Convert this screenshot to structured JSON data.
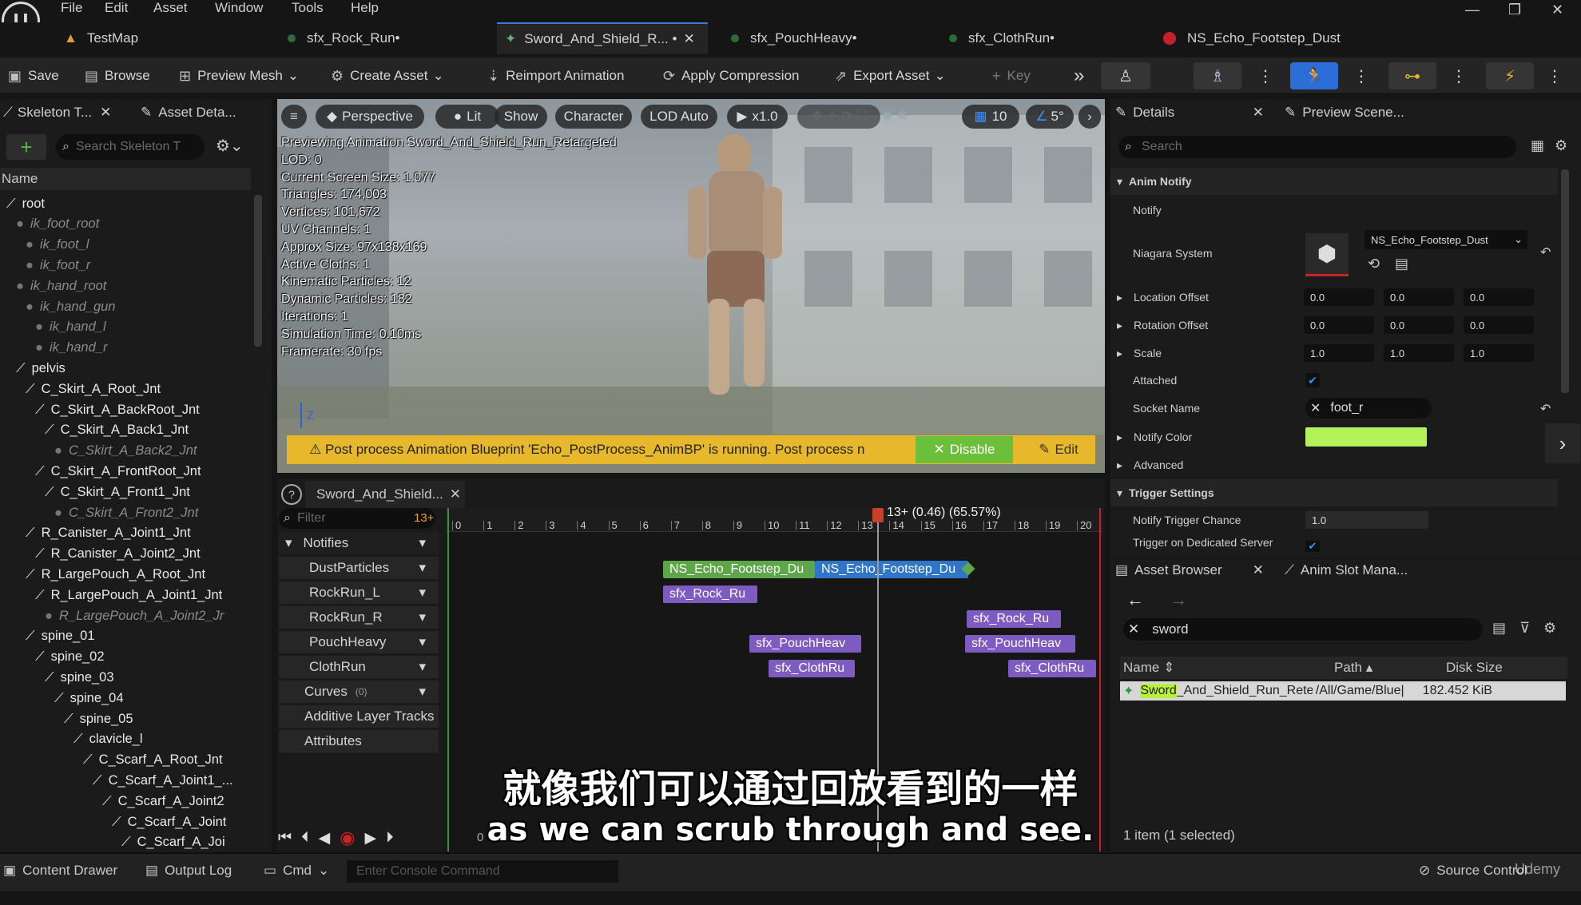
{
  "menu": {
    "items": [
      "File",
      "Edit",
      "Asset",
      "Window",
      "Tools",
      "Help"
    ],
    "logo": "U"
  },
  "tabs": [
    {
      "label": "TestMap",
      "icon": "level-icon"
    },
    {
      "label": "sfx_Rock_Run•",
      "icon": "sound-icon"
    },
    {
      "label": "Sword_And_Shield_R... •",
      "active": true,
      "icon": "anim-sequence-icon"
    },
    {
      "label": "sfx_PouchHeavy•",
      "icon": "sound-icon"
    },
    {
      "label": "sfx_ClothRun•",
      "icon": "sound-icon"
    },
    {
      "label": "NS_Echo_Footstep_Dust",
      "icon": "niagara-icon"
    }
  ],
  "toolbar": {
    "save": "Save",
    "browse": "Browse",
    "preview_mesh": "Preview Mesh",
    "create_asset": "Create Asset",
    "reimport": "Reimport Animation",
    "apply_compression": "Apply Compression",
    "export_asset": "Export Asset",
    "key": "Key"
  },
  "left_panel": {
    "tab1": "Skeleton T...",
    "tab2": "Asset Deta...",
    "search_placeholder": "Search Skeleton T",
    "column": "Name",
    "tree": [
      {
        "label": "root",
        "depth": 0,
        "kind": "bone"
      },
      {
        "label": "ik_foot_root",
        "depth": 1,
        "kind": "dim"
      },
      {
        "label": "ik_foot_l",
        "depth": 2,
        "kind": "dim"
      },
      {
        "label": "ik_foot_r",
        "depth": 2,
        "kind": "dim"
      },
      {
        "label": "ik_hand_root",
        "depth": 1,
        "kind": "dim"
      },
      {
        "label": "ik_hand_gun",
        "depth": 2,
        "kind": "dim"
      },
      {
        "label": "ik_hand_l",
        "depth": 3,
        "kind": "dim"
      },
      {
        "label": "ik_hand_r",
        "depth": 3,
        "kind": "dim"
      },
      {
        "label": "pelvis",
        "depth": 1,
        "kind": "bone"
      },
      {
        "label": "C_Skirt_A_Root_Jnt",
        "depth": 2,
        "kind": "bone"
      },
      {
        "label": "C_Skirt_A_BackRoot_Jnt",
        "depth": 3,
        "kind": "bone"
      },
      {
        "label": "C_Skirt_A_Back1_Jnt",
        "depth": 4,
        "kind": "bone"
      },
      {
        "label": "C_Skirt_A_Back2_Jnt",
        "depth": 5,
        "kind": "dim"
      },
      {
        "label": "C_Skirt_A_FrontRoot_Jnt",
        "depth": 3,
        "kind": "bone"
      },
      {
        "label": "C_Skirt_A_Front1_Jnt",
        "depth": 4,
        "kind": "bone"
      },
      {
        "label": "C_Skirt_A_Front2_Jnt",
        "depth": 5,
        "kind": "dim"
      },
      {
        "label": "R_Canister_A_Joint1_Jnt",
        "depth": 2,
        "kind": "bone"
      },
      {
        "label": "R_Canister_A_Joint2_Jnt",
        "depth": 3,
        "kind": "bone"
      },
      {
        "label": "R_LargePouch_A_Root_Jnt",
        "depth": 2,
        "kind": "bone"
      },
      {
        "label": "R_LargePouch_A_Joint1_Jnt",
        "depth": 3,
        "kind": "bone"
      },
      {
        "label": "R_LargePouch_A_Joint2_Jr",
        "depth": 4,
        "kind": "dim"
      },
      {
        "label": "spine_01",
        "depth": 2,
        "kind": "bone"
      },
      {
        "label": "spine_02",
        "depth": 3,
        "kind": "bone"
      },
      {
        "label": "spine_03",
        "depth": 4,
        "kind": "bone"
      },
      {
        "label": "spine_04",
        "depth": 5,
        "kind": "bone"
      },
      {
        "label": "spine_05",
        "depth": 6,
        "kind": "bone"
      },
      {
        "label": "clavicle_l",
        "depth": 7,
        "kind": "bone"
      },
      {
        "label": "C_Scarf_A_Root_Jnt",
        "depth": 8,
        "kind": "bone"
      },
      {
        "label": "C_Scarf_A_Joint1_...",
        "depth": 9,
        "kind": "bone"
      },
      {
        "label": "C_Scarf_A_Joint2",
        "depth": 10,
        "kind": "bone"
      },
      {
        "label": "C_Scarf_A_Joint",
        "depth": 11,
        "kind": "bone"
      },
      {
        "label": "C_Scarf_A_Joi",
        "depth": 12,
        "kind": "bone"
      }
    ]
  },
  "viewport": {
    "perspective": "Perspective",
    "lit": "Lit",
    "show": "Show",
    "character": "Character",
    "lod": "LOD Auto",
    "speed": "x1.0",
    "grid": "10",
    "angle": "5°",
    "stats": [
      "Previewing Animation Sword_And_Shield_Run_Retargeted",
      "LOD: 0",
      "Current Screen Size: 1.077",
      "Triangles: 174,003",
      "Vertices: 101,672",
      "UV Channels: 1",
      "Approx Size: 97x138x169",
      "Active Cloths: 1",
      "Kinematic Particles: 12",
      "Dynamic Particles: 182",
      "Iterations: 1",
      "Simulation Time: 0.10ms",
      "Framerate: 30 fps"
    ],
    "axis": "Z",
    "warning": "⚠ Post process Animation Blueprint 'Echo_PostProcess_AnimBP' is running. Post process n",
    "disable": "Disable",
    "edit": "Edit"
  },
  "sequencer": {
    "tab": "Sword_And_Shield...",
    "filter": "Filter",
    "frame": "13+",
    "playhead": "13+ (0.46) (65.57%)",
    "start": "0",
    "end": "20+",
    "tracks": [
      "Notifies",
      "DustParticles",
      "RockRun_L",
      "RockRun_R",
      "PouchHeavy",
      "ClothRun",
      "Curves",
      "Additive Layer Tracks",
      "Attributes"
    ],
    "curves_count": "(0)",
    "ticks": [
      "0",
      "1",
      "2",
      "3",
      "4",
      "5",
      "6",
      "7",
      "8",
      "9",
      "10",
      "11",
      "12",
      "13",
      "14",
      "15",
      "16",
      "17",
      "18",
      "19",
      "20"
    ],
    "notifies": {
      "dust1": "NS_Echo_Footstep_Du",
      "dust2": "NS_Echo_Footstep_Du",
      "rock1": "sfx_Rock_Ru",
      "rock2": "sfx_Rock_Ru",
      "pouch1": "sfx_PouchHeav",
      "pouch2": "sfx_PouchHeav",
      "cloth1": "sfx_ClothRu",
      "cloth2": "sfx_ClothRu"
    }
  },
  "details": {
    "tab1": "Details",
    "tab2": "Preview Scene...",
    "search": "Search",
    "section1": "Anim Notify",
    "notify": "Notify",
    "niagara": "Niagara System",
    "niagara_value": "NS_Echo_Footstep_Dust",
    "location": "Location Offset",
    "rotation": "Rotation Offset",
    "scale": "Scale",
    "attached": "Attached",
    "socket": "Socket Name",
    "socket_value": "foot_r",
    "notify_color": "Notify Color",
    "advanced": "Advanced",
    "section2": "Trigger Settings",
    "trigger_chance": "Notify Trigger Chance",
    "trigger_value": "1.0",
    "dedicated": "Trigger on Dedicated Server",
    "loc": [
      "0.0",
      "0.0",
      "0.0"
    ],
    "rot": [
      "0.0",
      "0.0",
      "0.0"
    ],
    "scl": [
      "1.0",
      "1.0",
      "1.0"
    ],
    "color_swatch": "#b4f25a"
  },
  "asset_browser": {
    "tab1": "Asset Browser",
    "tab2": "Anim Slot Mana...",
    "search": "sword",
    "col_name": "Name",
    "col_path": "Path",
    "col_size": "Disk Size",
    "row": {
      "name_hl": "Sword",
      "name_rest": "_And_Shield_Run_Rete",
      "path": "/All/Game/Blue|",
      "size": "182.452 KiB"
    },
    "status": "1 item (1 selected)"
  },
  "bottom": {
    "content_drawer": "Content Drawer",
    "output_log": "Output Log",
    "cmd": "Cmd",
    "console_placeholder": "Enter Console Command",
    "source_control": "Source Control",
    "watermark": "Udemy"
  },
  "subtitles": {
    "zh": "就像我们可以通过回放看到的一样",
    "en": "as we can scrub through and see."
  }
}
